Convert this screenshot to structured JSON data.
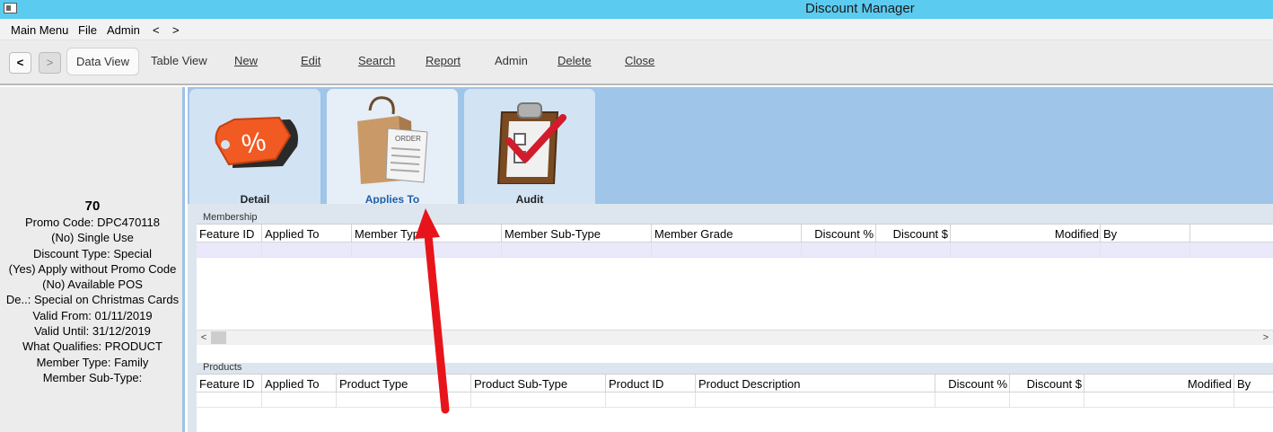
{
  "window": {
    "title": "Discount Manager"
  },
  "menu": {
    "items": [
      "Main Menu",
      "File",
      "Admin",
      "<",
      ">"
    ]
  },
  "toolbar": {
    "back": "<",
    "forward": ">",
    "data_view": "Data View",
    "table_view": "Table View",
    "new": "New",
    "edit": "Edit",
    "search": "Search",
    "report": "Report",
    "admin": "Admin",
    "delete": "Delete",
    "close": "Close"
  },
  "summary": {
    "id": "70",
    "lines": [
      "Promo Code: DPC470118",
      "(No) Single Use",
      "Discount Type: Special",
      "(Yes) Apply without Promo Code",
      "(No) Available POS",
      "De..: Special on Christmas Cards",
      "Valid From: 01/11/2019",
      "Valid Until: 31/12/2019",
      "What Qualifies: PRODUCT",
      "Member Type: Family",
      "Member Sub-Type:"
    ]
  },
  "tabs": [
    {
      "label": "Detail",
      "icon": "discount-tag-icon",
      "active": false
    },
    {
      "label": "Applies To",
      "icon": "shopping-bag-order-icon",
      "active": true
    },
    {
      "label": "Audit",
      "icon": "clipboard-checkmark-icon",
      "active": false
    }
  ],
  "membership": {
    "title": "Membership",
    "columns": [
      "Feature ID",
      "Applied To",
      "Member Type",
      "Member Sub-Type",
      "Member Grade",
      "Discount %",
      "Discount $",
      "Modified",
      "By"
    ]
  },
  "products": {
    "title": "Products",
    "columns": [
      "Feature ID",
      "Applied To",
      "Product Type",
      "Product Sub-Type",
      "Product ID",
      "Product Description",
      "Discount %",
      "Discount $",
      "Modified",
      "By"
    ]
  },
  "scrollbar": {
    "left": "<",
    "right": ">"
  },
  "colors": {
    "titlebar": "#5ccbf0",
    "tabstrip": "#9fc5e8",
    "active_tab_label": "#1f5fa8",
    "annotation_arrow": "#e8141b"
  }
}
